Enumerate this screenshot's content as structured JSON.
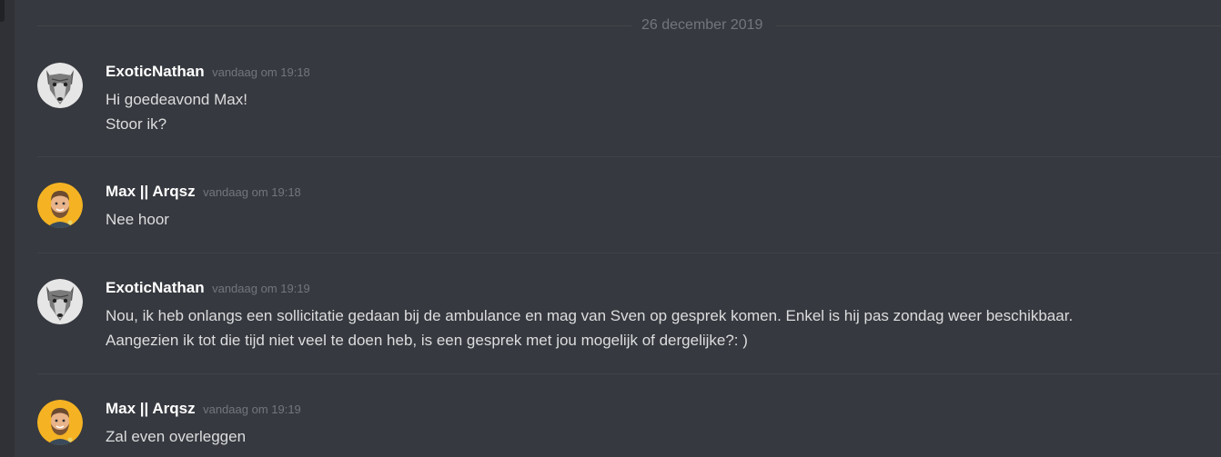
{
  "date_divider": "26 december 2019",
  "messages": [
    {
      "username": "ExoticNathan",
      "timestamp": "vandaag om 19:18",
      "avatar_icon": "wolf-avatar-icon",
      "lines": [
        "Hi goedeavond Max!",
        "Stoor ik?"
      ]
    },
    {
      "username": "Max || Arqsz",
      "timestamp": "vandaag om 19:18",
      "avatar_icon": "bearded-man-avatar-icon",
      "lines": [
        "Nee hoor"
      ]
    },
    {
      "username": "ExoticNathan",
      "timestamp": "vandaag om 19:19",
      "avatar_icon": "wolf-avatar-icon",
      "lines": [
        "Nou, ik heb onlangs een sollicitatie gedaan bij de ambulance en mag van Sven op gesprek komen. Enkel is hij pas zondag weer beschikbaar.",
        "Aangezien ik tot die tijd niet veel te doen heb, is een gesprek met jou mogelijk of dergelijke?: )"
      ]
    },
    {
      "username": "Max || Arqsz",
      "timestamp": "vandaag om 19:19",
      "avatar_icon": "bearded-man-avatar-icon",
      "lines": [
        "Zal even overleggen"
      ]
    }
  ],
  "colors": {
    "background": "#36393f",
    "username": "#ffffff",
    "message_text": "#dcddde",
    "timestamp": "#72767d",
    "avatar_yellow": "#f5b323"
  }
}
